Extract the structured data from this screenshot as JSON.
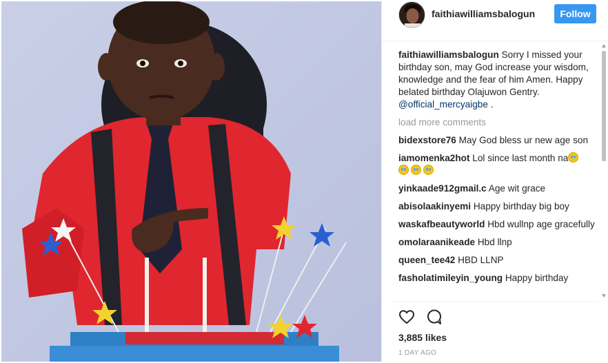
{
  "post": {
    "username": "faithiawilliamsbalogun",
    "follow_label": "Follow",
    "caption": {
      "username": "faithiawilliamsbalogun",
      "text": "Sorry I missed your birthday son, may God increase your wisdom, knowledge and the fear of him Amen. Happy belated birthday Olajuwon Gentry. ",
      "mention": "@official_mercyaigbe",
      "suffix": " ."
    },
    "load_more_label": "load more comments",
    "comments": [
      {
        "username": "bidexstore76",
        "text": "May God bless ur new age son",
        "emoji_count": 0,
        "emoji_name": ""
      },
      {
        "username": "iamomenka2hot",
        "text": "Lol since last month na",
        "emoji_count": 4,
        "emoji_name": "crying-laughing-emoji"
      },
      {
        "username": "yinkaade912gmail.c",
        "text": "Age wit grace",
        "emoji_count": 0,
        "emoji_name": ""
      },
      {
        "username": "abisolaakinyemi",
        "text": "Happy birthday big boy",
        "emoji_count": 0,
        "emoji_name": ""
      },
      {
        "username": "waskafbeautyworld",
        "text": "Hbd wullnp age gracefully",
        "emoji_count": 0,
        "emoji_name": ""
      },
      {
        "username": "omolaraanikeade",
        "text": "Hbd llnp",
        "emoji_count": 0,
        "emoji_name": ""
      },
      {
        "username": "queen_tee42",
        "text": "HBD LLNP",
        "emoji_count": 0,
        "emoji_name": ""
      },
      {
        "username": "fasholatimileyin_young",
        "text": "Happy birthday",
        "emoji_count": 0,
        "emoji_name": ""
      }
    ],
    "likes": "3,885 likes",
    "timestamp": "1 DAY AGO",
    "icons": {
      "like": "heart-icon",
      "comment": "speech-bubble-icon"
    },
    "colors": {
      "follow": "#3897f0",
      "mention": "#003569",
      "muted": "#999999",
      "text": "#262626"
    }
  }
}
